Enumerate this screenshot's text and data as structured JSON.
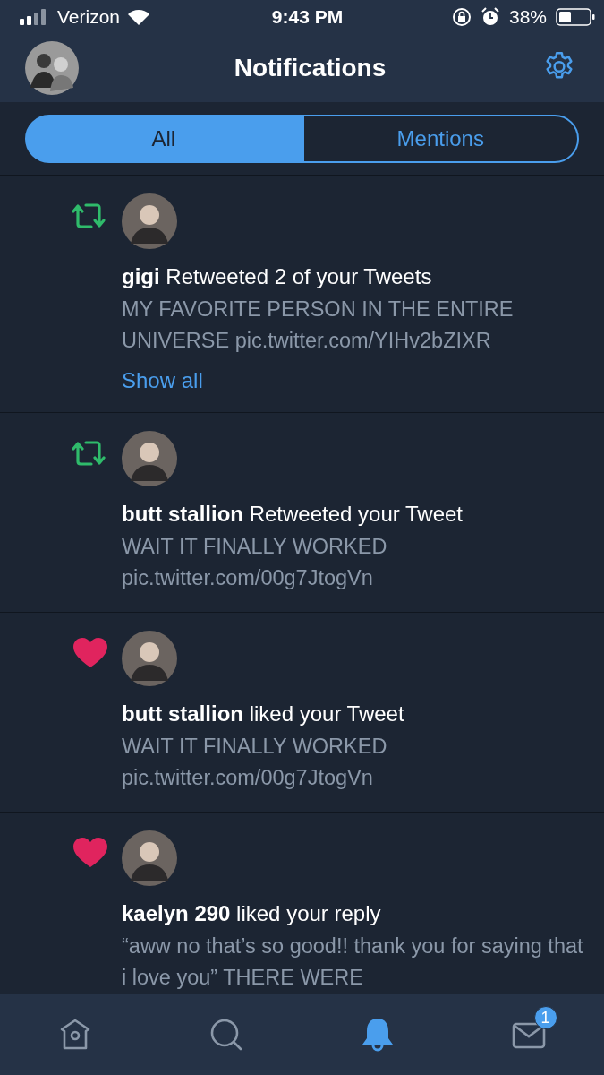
{
  "status_bar": {
    "carrier": "Verizon",
    "time": "9:43 PM",
    "battery": "38%"
  },
  "header": {
    "title": "Notifications"
  },
  "tabs": [
    {
      "label": "All",
      "selected": true
    },
    {
      "label": "Mentions",
      "selected": false
    }
  ],
  "notifications": [
    {
      "kind": "retweet",
      "name": "gigi",
      "action": "Retweeted 2 of your Tweets",
      "text": "MY FAVORITE PERSON IN THE ENTIRE UNIVERSE pic.twitter.com/YIHv2bZIXR",
      "link": "Show all"
    },
    {
      "kind": "retweet",
      "name": "butt stallion",
      "action": "Retweeted your Tweet",
      "text": "WAIT IT FINALLY WORKED pic.twitter.com/00g7JtogVn"
    },
    {
      "kind": "like",
      "name": "butt stallion",
      "action": "liked your Tweet",
      "text": "WAIT IT FINALLY WORKED pic.twitter.com/00g7JtogVn"
    },
    {
      "kind": "like",
      "name": "kaelyn 290",
      "action": "liked your reply",
      "text": "“aww no that’s so good!! thank you for saying that i love you” THERE WERE"
    }
  ],
  "nav": [
    {
      "kind": "home",
      "selected": false
    },
    {
      "kind": "search",
      "selected": false
    },
    {
      "kind": "notifications",
      "selected": true
    },
    {
      "kind": "messages",
      "selected": false,
      "badge": "1"
    }
  ]
}
